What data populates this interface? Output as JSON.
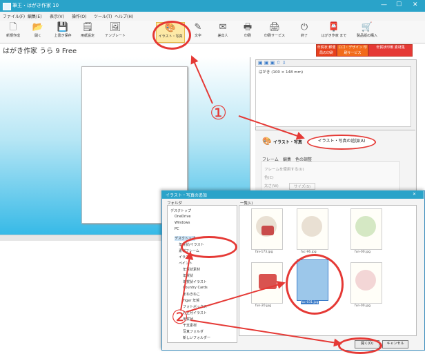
{
  "window": {
    "title": "筆王・はがき作家 10"
  },
  "menu": [
    "ファイル(F)",
    "編集(E)",
    "表示(V)",
    "操作(O)",
    "ツール(T)",
    "ヘルプ(H)"
  ],
  "toolbar": [
    {
      "label": "新規作成",
      "icon": "new-file-icon"
    },
    {
      "label": "開く",
      "icon": "open-folder-icon"
    },
    {
      "label": "上書き保存",
      "icon": "save-icon"
    },
    {
      "label": "用紙設定",
      "icon": "paper-settings-icon"
    },
    {
      "label": "テンプレート",
      "icon": "template-icon"
    },
    {
      "label": "イラスト・写真",
      "icon": "illustration-icon",
      "selected": true
    },
    {
      "label": "文字",
      "icon": "text-icon"
    },
    {
      "label": "差出人",
      "icon": "sender-icon"
    },
    {
      "label": "印刷",
      "icon": "print-icon"
    },
    {
      "label": "印刷サービス",
      "icon": "print-service-icon"
    },
    {
      "label": "終了",
      "icon": "exit-icon"
    },
    {
      "label": "はがき作家 まで",
      "icon": "hagaki-icon"
    },
    {
      "label": "製品版の購入",
      "icon": "cart-icon"
    }
  ],
  "promos": [
    {
      "text": "年賀状 郵便局の印刷",
      "color": "#e8401c"
    },
    {
      "text": "ロゴ・デザイン 印刷サービス",
      "color": "#f26a1b"
    },
    {
      "text": "年賀状印刷 素材集",
      "color": "#e53935"
    }
  ],
  "document": {
    "title": "はがき作家 うら 9 Free"
  },
  "pages": {
    "item": "はがき (100 × 148 mm)"
  },
  "illust_panel": {
    "label": "イラスト・写真",
    "add_button": "イラスト・写真の追加(A)",
    "tabs": [
      "フレーム",
      "編集",
      "色の調整"
    ],
    "checkbox": "フレームを使用する(U)",
    "field1": "色(C)",
    "field2": "太さ(W)",
    "field2_value": "サイズ(S)"
  },
  "dialog": {
    "title": "イラスト・写真の追加",
    "tree_header": "フォルダ",
    "list_header": "一覧(L)",
    "tree": [
      "デスクトップ",
      "OneDrive",
      "Windows",
      "PC",
      "デスクトップ",
      "年賀状/イラスト",
      "素材フレーム",
      "イラスト",
      "ペイント",
      "年賀状素材",
      "年賀状",
      "年賀状イラスト",
      "Country Cards",
      "まねきねこ",
      "Tiger 年賀",
      "フォトボックス",
      "お正月イラスト",
      "年賀状",
      "干支素材",
      "写真フォルダ",
      "新しいフォルダー"
    ],
    "files": [
      "fav-173.jpg",
      "fuc-96.jpg",
      "fun-00.jpg",
      "fun-20.jpg",
      "fuc-031.jpg",
      "fun-00.jpg"
    ],
    "ok": "開く(O)",
    "cancel": "キャンセル"
  },
  "annotations": {
    "step1": "①",
    "step2": "②",
    "color": "#e53935"
  }
}
